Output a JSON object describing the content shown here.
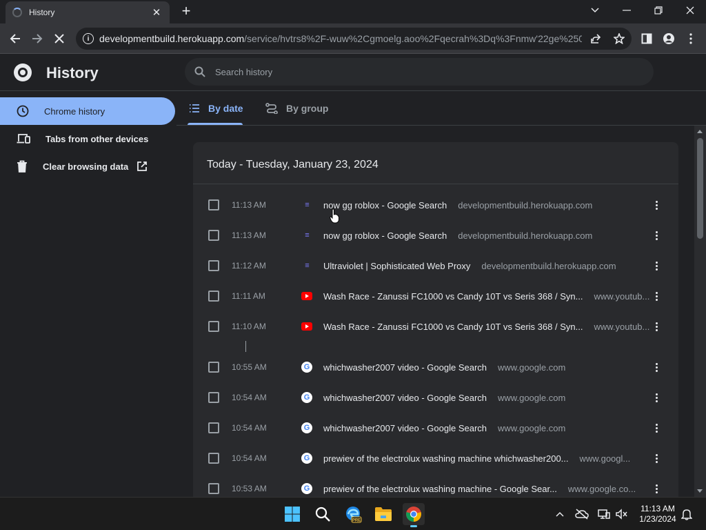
{
  "browser": {
    "tab_title": "History",
    "url_host": "developmentbuild.herokuapp.com",
    "url_path": "/service/hvtrs8%2F-wuw%2Cgmoelg.aoo%2Fqecrah%3Dq%3Fnmw'22ge%250..."
  },
  "history": {
    "title": "History",
    "search_placeholder": "Search history",
    "sidebar": [
      {
        "label": "Chrome history",
        "icon": "clock-icon",
        "active": true
      },
      {
        "label": "Tabs from other devices",
        "icon": "devices-icon",
        "active": false
      },
      {
        "label": "Clear browsing data",
        "icon": "trash-icon",
        "active": false
      }
    ],
    "tabs": [
      {
        "label": "By date",
        "icon": "list-icon",
        "active": true
      },
      {
        "label": "By group",
        "icon": "group-icon",
        "active": false
      }
    ],
    "date_header": "Today - Tuesday, January 23, 2024",
    "entries": [
      {
        "time": "11:13 AM",
        "favicon": "ultraviolet-icon",
        "title": "now gg roblox - Google Search",
        "domain": "developmentbuild.herokuapp.com"
      },
      {
        "time": "11:13 AM",
        "favicon": "ultraviolet-icon",
        "title": "now gg roblox - Google Search",
        "domain": "developmentbuild.herokuapp.com"
      },
      {
        "time": "11:12 AM",
        "favicon": "ultraviolet-icon",
        "title": "Ultraviolet | Sophisticated Web Proxy",
        "domain": "developmentbuild.herokuapp.com"
      },
      {
        "time": "11:11 AM",
        "favicon": "youtube-icon",
        "title": "Wash Race - Zanussi FC1000 vs Candy 10T vs Seris 368 / Syn...",
        "domain": "www.youtub..."
      },
      {
        "time": "11:10 AM",
        "favicon": "youtube-icon",
        "title": "Wash Race - Zanussi FC1000 vs Candy 10T vs Seris 368 / Syn...",
        "domain": "www.youtub..."
      },
      {
        "time": "10:55 AM",
        "favicon": "google-icon",
        "title": "whichwasher2007 video - Google Search",
        "domain": "www.google.com"
      },
      {
        "time": "10:54 AM",
        "favicon": "google-icon",
        "title": "whichwasher2007 video - Google Search",
        "domain": "www.google.com"
      },
      {
        "time": "10:54 AM",
        "favicon": "google-icon",
        "title": "whichwasher2007 video - Google Search",
        "domain": "www.google.com"
      },
      {
        "time": "10:54 AM",
        "favicon": "google-icon",
        "title": "prewiev of the electrolux washing machine whichwasher200...",
        "domain": "www.googl..."
      },
      {
        "time": "10:53 AM",
        "favicon": "google-icon",
        "title": "prewiev of the electrolux washing machine - Google Sear...",
        "domain": "www.google.co..."
      }
    ]
  },
  "taskbar": {
    "clock_time": "11:13 AM",
    "clock_date": "1/23/2024",
    "edge_badge": "PRE"
  },
  "colors": {
    "accent": "#8ab4f8",
    "background": "#202124",
    "card": "#292a2d"
  }
}
